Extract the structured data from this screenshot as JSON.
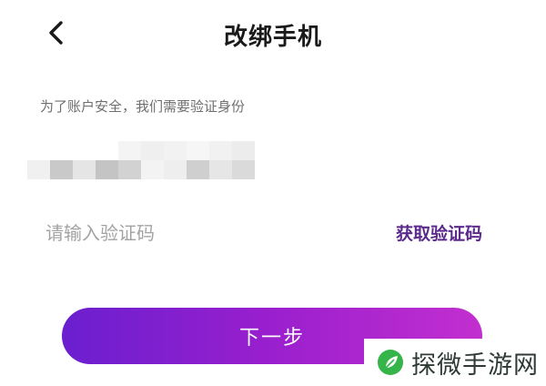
{
  "header": {
    "title": "改绑手机",
    "back_icon": "chevron-left-icon"
  },
  "hint": "为了账户安全，我们需要验证身份",
  "phone": {
    "masked": true
  },
  "code_input": {
    "placeholder": "请输入验证码",
    "value": ""
  },
  "get_code_label": "获取验证码",
  "next_button_label": "下一步",
  "watermark": {
    "text": "探微手游网",
    "icon": "leaf-logo-icon"
  },
  "colors": {
    "accent": "#5b2a8c",
    "button_gradient_start": "#6a1fcf",
    "button_gradient_end": "#c22fcf",
    "logo_green": "#35b44a"
  }
}
